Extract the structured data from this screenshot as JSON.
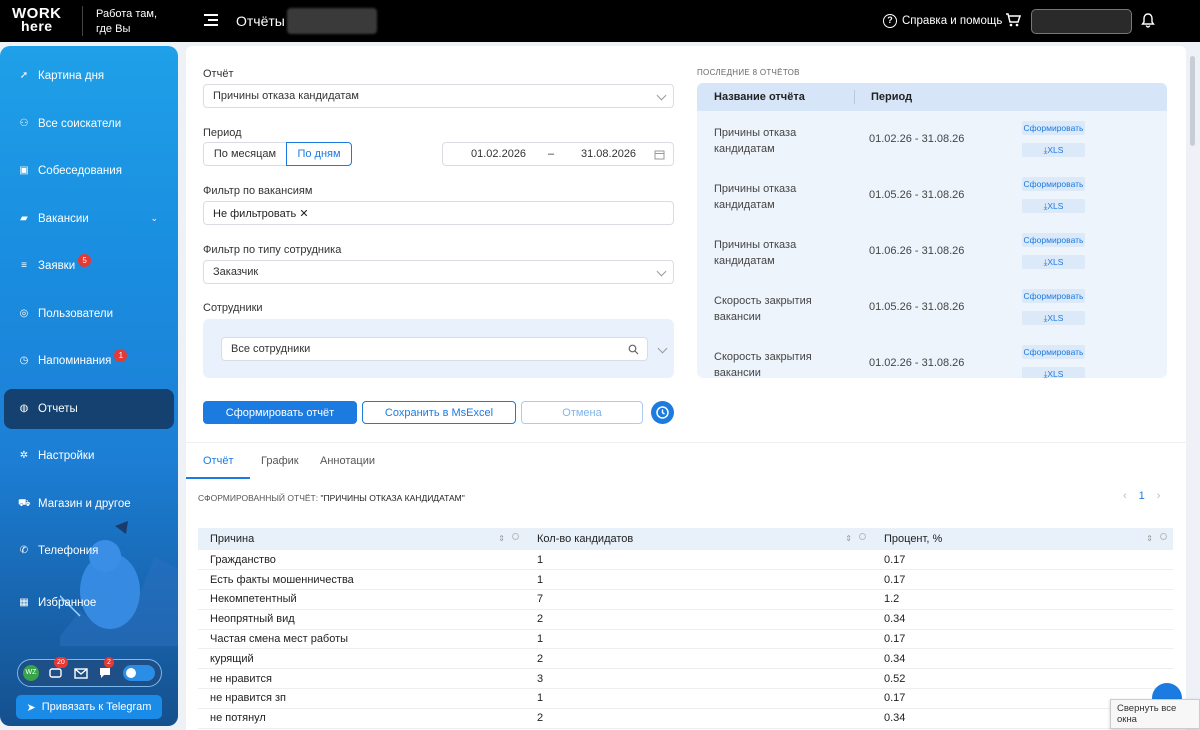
{
  "header": {
    "logo_line1": "WORK",
    "logo_line2": "here",
    "slogan": "Работа там, где Вы",
    "page_title": "Отчёты",
    "help_label": "Справка и помощь"
  },
  "sidebar": {
    "items": [
      {
        "label": "Картина дня",
        "icon": "rocket-icon"
      },
      {
        "label": "Все соискатели",
        "icon": "people-icon"
      },
      {
        "label": "Собеседования",
        "icon": "calendar-icon"
      },
      {
        "label": "Вакансии",
        "icon": "briefcase-icon"
      },
      {
        "label": "Заявки",
        "icon": "list-icon",
        "badge": "5"
      },
      {
        "label": "Пользователи",
        "icon": "user-circle-icon"
      },
      {
        "label": "Напоминания",
        "icon": "clock-icon",
        "badge": "1"
      },
      {
        "label": "Отчеты",
        "icon": "report-icon"
      },
      {
        "label": "Настройки",
        "icon": "gear-icon"
      },
      {
        "label": "Магазин и другое",
        "icon": "cart-icon"
      },
      {
        "label": "Телефония",
        "icon": "phone-icon"
      },
      {
        "label": "Избранное",
        "icon": "grid-icon"
      }
    ],
    "tray": {
      "wz_label": "WZ",
      "chat_badge": "20",
      "messages_badge": "2"
    },
    "telegram_button": "Привязать к Telegram"
  },
  "form": {
    "report_label": "Отчёт",
    "report_value": "Причины отказа кандидатам",
    "period_label": "Период",
    "period_by_month": "По месяцам",
    "period_by_day": "По дням",
    "date_from": "01.02.2026",
    "date_sep": "–",
    "date_to": "31.08.2026",
    "vacancy_filter_label": "Фильтр по вакансиям",
    "vacancy_filter_chip": "Не фильтровать",
    "employee_type_label": "Фильтр по типу сотрудника",
    "employee_type_value": "Заказчик",
    "employees_label": "Сотрудники",
    "employees_value": "Все сотрудники",
    "generate_button": "Сформировать отчёт",
    "save_excel_button": "Сохранить в MsExcel",
    "cancel_button": "Отмена"
  },
  "recent": {
    "title": "ПОСЛЕДНИЕ 8 ОТЧЁТОВ",
    "col_name": "Название отчёта",
    "col_period": "Период",
    "generate_label": "Сформировать",
    "xls_label": "XLS",
    "rows": [
      {
        "name": "Причины отказа кандидатам",
        "period": "01.02.26 - 31.08.26"
      },
      {
        "name": "Причины отказа кандидатам",
        "period": "01.05.26 - 31.08.26"
      },
      {
        "name": "Причины отказа кандидатам",
        "period": "01.06.26 - 31.08.26"
      },
      {
        "name": "Скорость закрытия вакансии",
        "period": "01.05.26 - 31.08.26"
      },
      {
        "name": "Скорость закрытия вакансии",
        "period": "01.02.26 - 31.08.26"
      }
    ]
  },
  "tabs": [
    "Отчёт",
    "График",
    "Аннотации"
  ],
  "report": {
    "caption_prefix": "СФОРМИРОВАННЫЙ ОТЧЁТ:",
    "caption_name": "\"ПРИЧИНЫ ОТКАЗА КАНДИДАТАМ\"",
    "page": "1",
    "columns": [
      "Причина",
      "Кол-во кандидатов",
      "Процент, %"
    ],
    "rows": [
      [
        "Гражданство",
        "1",
        "0.17"
      ],
      [
        "Есть факты мошенничества",
        "1",
        "0.17"
      ],
      [
        "Некомпетентный",
        "7",
        "1.2"
      ],
      [
        "Неопрятный вид",
        "2",
        "0.34"
      ],
      [
        "Частая смена мест работы",
        "1",
        "0.17"
      ],
      [
        "курящий",
        "2",
        "0.34"
      ],
      [
        "не нравится",
        "3",
        "0.52"
      ],
      [
        "не нравится зп",
        "1",
        "0.17"
      ],
      [
        "не потянул",
        "2",
        "0.34"
      ]
    ]
  },
  "tooltip": "Свернуть все окна",
  "colors": {
    "accent": "#1b7be0",
    "topbar": "#000000",
    "sidebar_active": "#14416f"
  }
}
